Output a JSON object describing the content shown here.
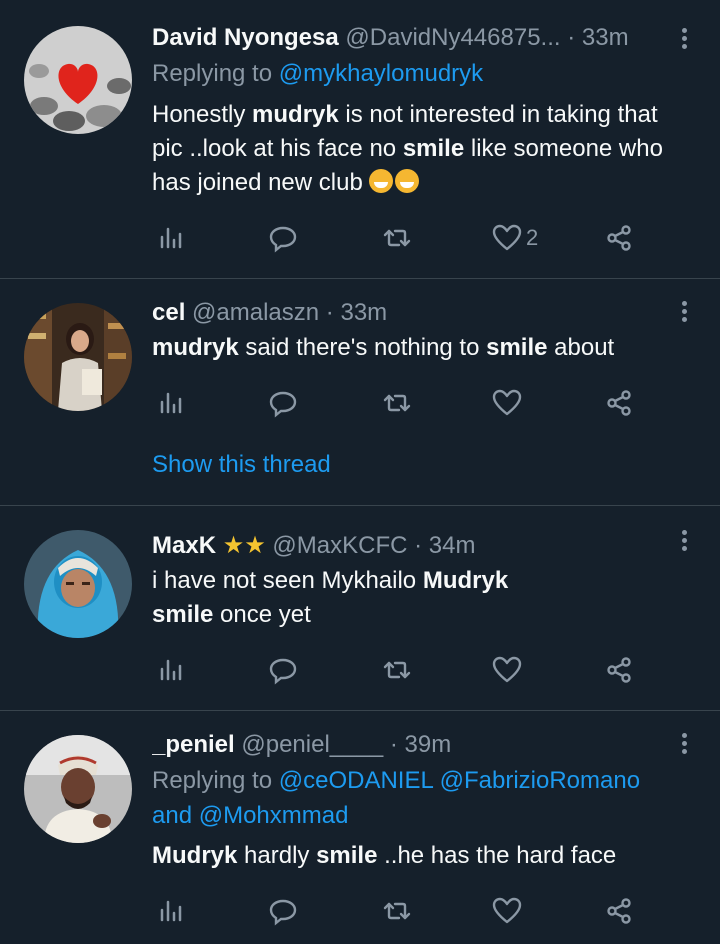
{
  "tweets": [
    {
      "name": "David Nyongesa",
      "handle": "@DavidNy446875...",
      "dot": "·",
      "time": "33m",
      "reply_prefix": "Replying to",
      "reply_to": "@mykhaylomudryk",
      "body": [
        {
          "t": "Honestly ",
          "b": false
        },
        {
          "t": "mudryk",
          "b": true
        },
        {
          "t": " is not interested in taking that pic ..look at his face no ",
          "b": false
        },
        {
          "t": "smile",
          "b": true
        },
        {
          "t": " like someone who has joined new club ",
          "b": false
        }
      ],
      "like_count": "2"
    },
    {
      "name": "cel",
      "handle": "@amalaszn",
      "dot": "·",
      "time": "33m",
      "body": [
        {
          "t": "mudryk",
          "b": true
        },
        {
          "t": " said there's nothing to ",
          "b": false
        },
        {
          "t": "smile",
          "b": true
        },
        {
          "t": " about",
          "b": false
        }
      ],
      "show_thread": "Show this thread"
    },
    {
      "name": "MaxK",
      "stars": "★★",
      "handle": "@MaxKCFC",
      "dot": "·",
      "time": "34m",
      "body": [
        {
          "t": "i have not seen Mykhailo ",
          "b": false
        },
        {
          "t": "Mudryk",
          "b": true
        },
        {
          "t": " smile",
          "b": true
        },
        {
          "t": " once yet",
          "b": false
        }
      ]
    },
    {
      "name": "_peniel",
      "handle": "@peniel____",
      "dot": "·",
      "time": "39m",
      "reply_prefix": "Replying to",
      "reply_to": "@ceODANIEL",
      "reply_to_2": "@FabrizioRomano",
      "reply_and": "and",
      "reply_to_3": "@Mohxmmad",
      "body": [
        {
          "t": "Mudryk",
          "b": true
        },
        {
          "t": " hardly ",
          "b": false
        },
        {
          "t": "smile",
          "b": true
        },
        {
          "t": " ..he has the hard face",
          "b": false
        }
      ]
    }
  ],
  "icons": [
    "analytics-icon",
    "reply-icon",
    "retweet-icon",
    "like-icon",
    "share-icon",
    "more-icon"
  ],
  "colors": {
    "background": "#15202b",
    "link": "#1d9bf0",
    "muted": "#8b98a5",
    "divider": "#38444d"
  }
}
